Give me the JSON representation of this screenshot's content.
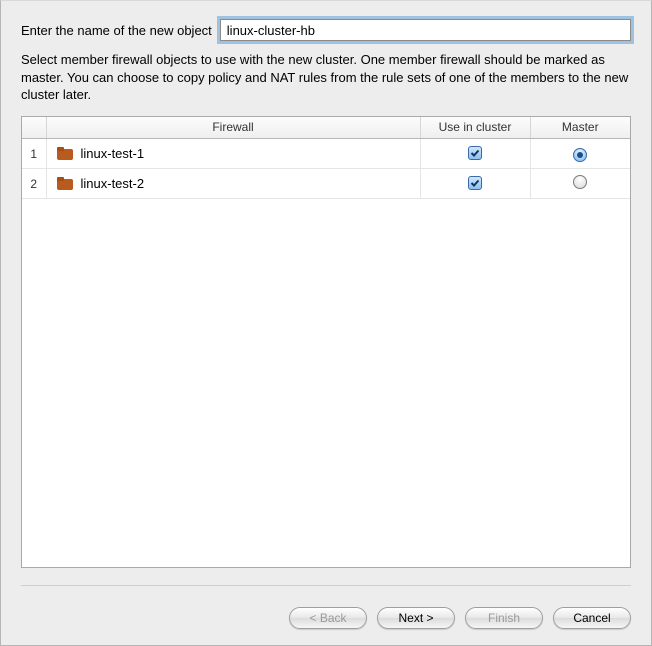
{
  "name_field": {
    "label": "Enter the name of the new object",
    "value": "linux-cluster-hb"
  },
  "description": "Select member firewall objects to use with the new cluster. One member firewall should be marked as master. You can choose to copy policy and NAT rules from the rule sets of one of the members to the new cluster later.",
  "table": {
    "columns": {
      "firewall": "Firewall",
      "use": "Use in cluster",
      "master": "Master"
    },
    "rows": [
      {
        "index": "1",
        "name": "linux-test-1",
        "use_in_cluster": true,
        "master": true
      },
      {
        "index": "2",
        "name": "linux-test-2",
        "use_in_cluster": true,
        "master": false
      }
    ]
  },
  "buttons": {
    "back": {
      "label": "< Back",
      "enabled": false
    },
    "next": {
      "label": "Next >",
      "enabled": true
    },
    "finish": {
      "label": "Finish",
      "enabled": false
    },
    "cancel": {
      "label": "Cancel",
      "enabled": true
    }
  }
}
